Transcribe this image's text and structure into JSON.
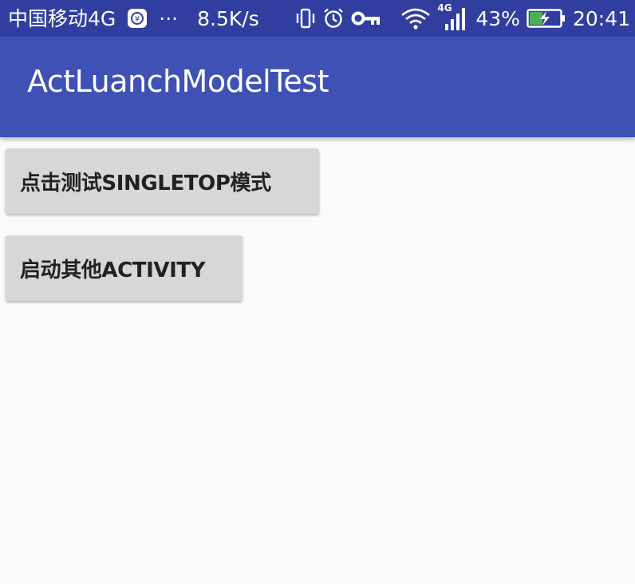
{
  "status_bar": {
    "carrier": "中国移动4G",
    "more": "···",
    "net_speed": "8.5K/s",
    "signal_type": "4G",
    "battery_percent": "43%",
    "time": "20:41",
    "icons": [
      "vpn-shield-icon",
      "vibrate-icon",
      "alarm-icon",
      "key-icon",
      "wifi-icon",
      "signal-icon",
      "battery-charging-icon"
    ],
    "colors": {
      "background": "#303f9f",
      "battery_fill": "#4caf50"
    }
  },
  "app_bar": {
    "title": "ActLuanchModelTest",
    "color": "#3f51b5"
  },
  "buttons": {
    "singletop_label": "点击测试SINGLETOP模式",
    "launch_other_label": "启动其他ACTIVITY"
  }
}
